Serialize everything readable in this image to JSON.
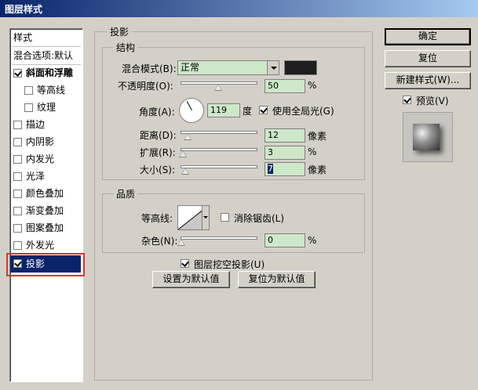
{
  "window": {
    "title": "图层样式"
  },
  "styles_list": {
    "header": "样式",
    "blend_options": "混合选项:默认",
    "items": [
      {
        "label": "斜面和浮雕",
        "checked": true,
        "bold": true
      },
      {
        "label": "等高线",
        "checked": false,
        "indent": true
      },
      {
        "label": "纹理",
        "checked": false,
        "indent": true
      },
      {
        "label": "描边",
        "checked": false
      },
      {
        "label": "内阴影",
        "checked": false
      },
      {
        "label": "内发光",
        "checked": false
      },
      {
        "label": "光泽",
        "checked": false
      },
      {
        "label": "颜色叠加",
        "checked": false
      },
      {
        "label": "渐变叠加",
        "checked": false
      },
      {
        "label": "图案叠加",
        "checked": false
      },
      {
        "label": "外发光",
        "checked": false
      },
      {
        "label": "投影",
        "checked": true,
        "selected": true
      }
    ]
  },
  "drop_shadow": {
    "section_title": "投影",
    "structure_title": "结构",
    "blend_mode_label": "混合模式(B):",
    "blend_mode_value": "正常",
    "shadow_color": "#000000",
    "opacity_label": "不透明度(O):",
    "opacity_value": "50",
    "opacity_unit": "%",
    "angle_label": "角度(A):",
    "angle_value": "119",
    "angle_unit": "度",
    "global_light_label": "使用全局光(G)",
    "global_light_checked": true,
    "distance_label": "距离(D):",
    "distance_value": "12",
    "distance_unit": "像素",
    "spread_label": "扩展(R):",
    "spread_value": "3",
    "spread_unit": "%",
    "size_label": "大小(S):",
    "size_value": "7",
    "size_unit": "像素",
    "quality_title": "品质",
    "contour_label": "等高线:",
    "anti_alias_label": "消除锯齿(L)",
    "anti_alias_checked": false,
    "noise_label": "杂色(N):",
    "noise_value": "0",
    "noise_unit": "%",
    "knockout_label": "图层挖空投影(U)",
    "knockout_checked": true,
    "make_default_label": "设置为默认值",
    "reset_default_label": "复位为默认值"
  },
  "buttons": {
    "ok": "确定",
    "reset": "复位",
    "new_style": "新建样式(W)...",
    "preview_label": "预览(V)",
    "preview_checked": true
  },
  "colors": {
    "titlebar_start": "#0a246a",
    "selection": "#0a246a",
    "highlight_box": "#e03030",
    "field_bg": "#cde8c8"
  }
}
